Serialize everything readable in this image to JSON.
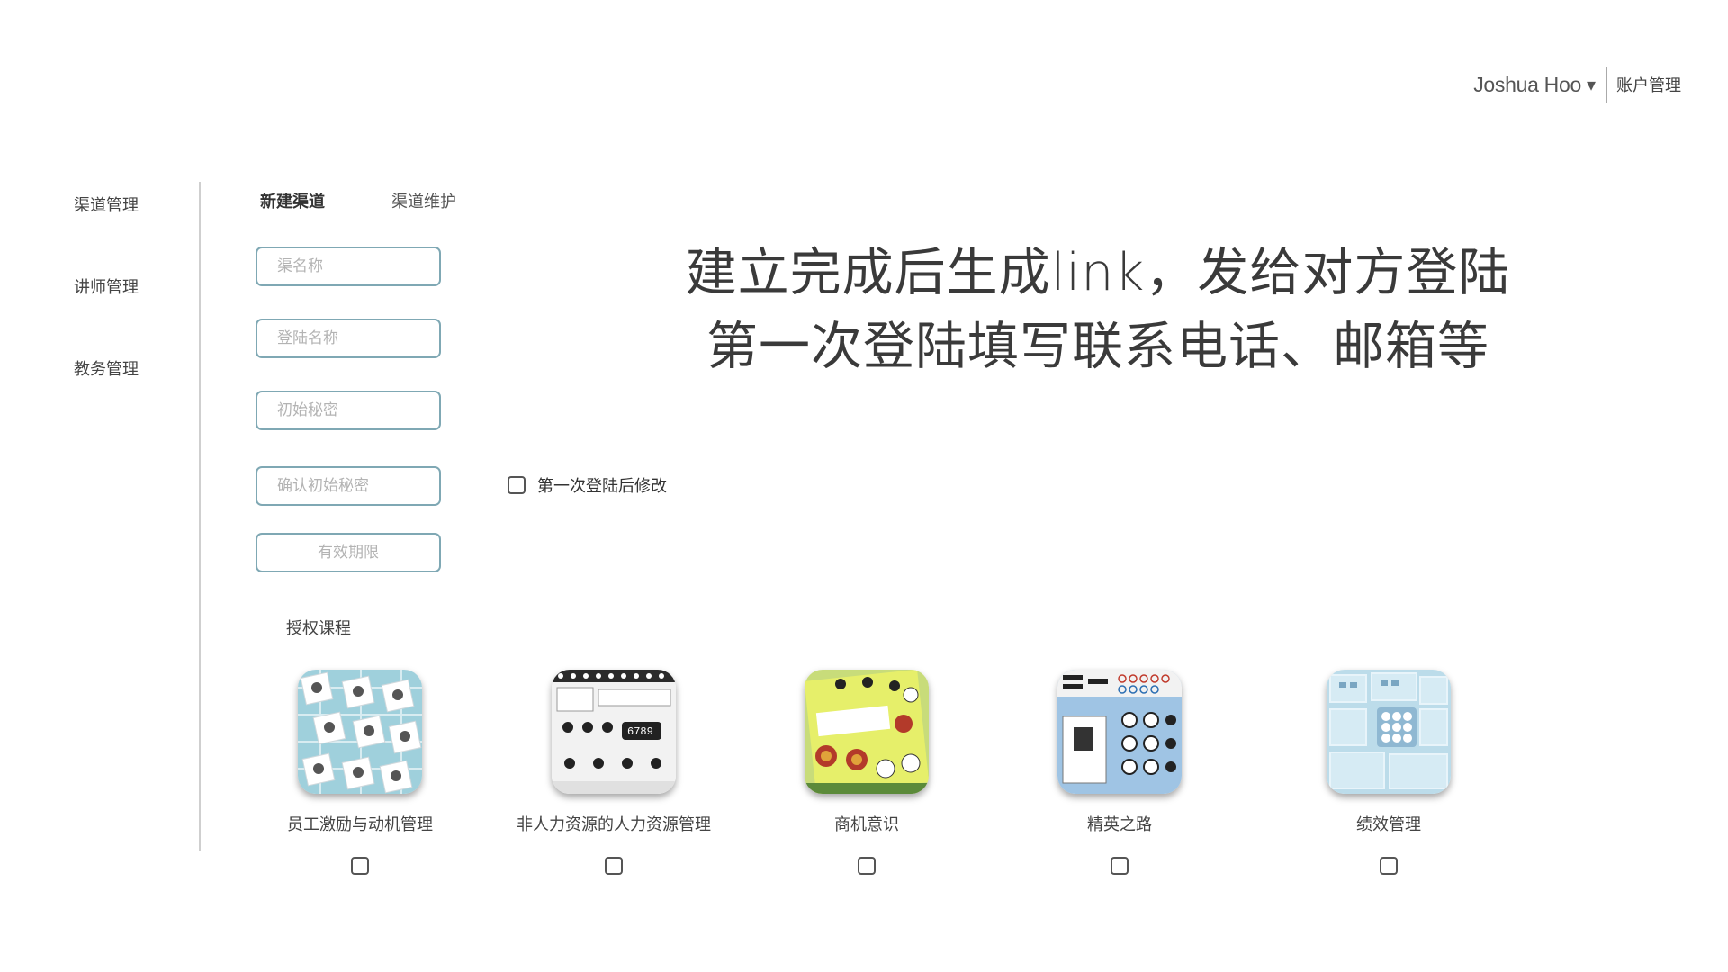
{
  "header": {
    "user_name": "Joshua Hoo",
    "caret": "▾",
    "account_label": "账户管理"
  },
  "nav": {
    "items": [
      {
        "label": "渠道管理"
      },
      {
        "label": "讲师管理"
      },
      {
        "label": "教务管理"
      }
    ]
  },
  "tabs": [
    {
      "label": "新建渠道",
      "active": true
    },
    {
      "label": "渠道维护",
      "active": false
    }
  ],
  "form": {
    "channel_name_placeholder": "渠名称",
    "login_name_placeholder": "登陆名称",
    "initial_password_placeholder": "初始秘密",
    "confirm_password_placeholder": "确认初始秘密",
    "valid_period_placeholder": "有效期限",
    "first_login_change_label": "第一次登陆后修改"
  },
  "note": {
    "line1": "建立完成后生成link，发给对方登陆",
    "line2": "第一次登陆填写联系电话、邮箱等"
  },
  "courses": {
    "title": "授权课程",
    "items": [
      {
        "label": "员工激励与动机管理",
        "icon": "employee-motivation-thumbnail"
      },
      {
        "label": "非人力资源的人力资源管理",
        "icon": "hr-for-non-hr-thumbnail"
      },
      {
        "label": "商机意识",
        "icon": "business-opportunity-thumbnail"
      },
      {
        "label": "精英之路",
        "icon": "elite-path-thumbnail"
      },
      {
        "label": "绩效管理",
        "icon": "performance-management-thumbnail"
      }
    ]
  },
  "colors": {
    "input_border": "#7fa8b4",
    "text": "#333333"
  }
}
